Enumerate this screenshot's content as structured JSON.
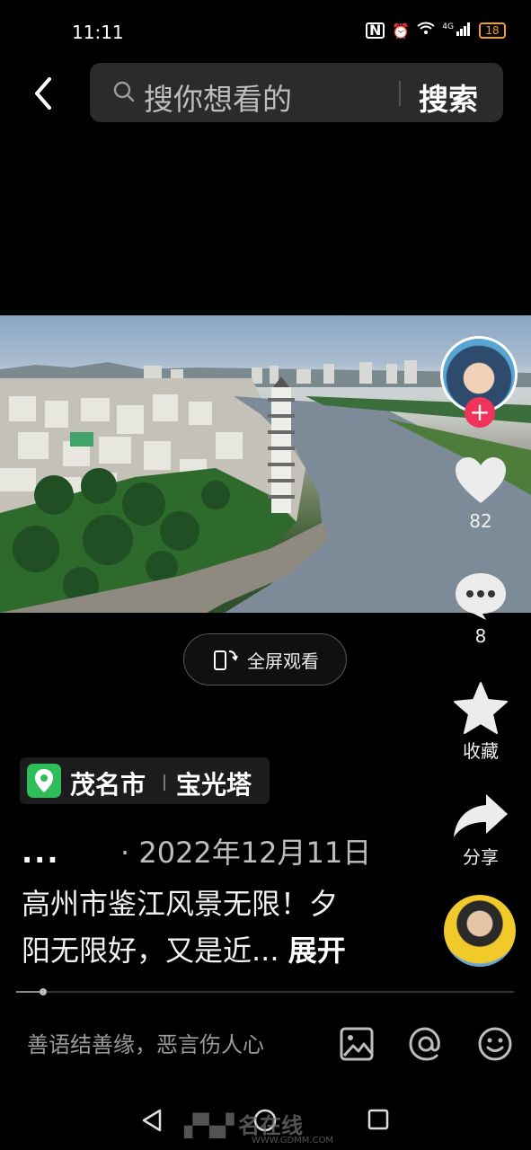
{
  "status_bar": {
    "time": "11:11",
    "network": "4G",
    "battery": "18"
  },
  "search": {
    "placeholder": "搜你想看的",
    "button_label": "搜索"
  },
  "fullscreen_label": "全屏观看",
  "rail": {
    "likes": "82",
    "comments": "8",
    "favorite_label": "收藏",
    "share_label": "分享"
  },
  "location": {
    "city": "茂名市",
    "place": "宝光塔"
  },
  "post": {
    "author": "...",
    "date": "· 2022年12月11日",
    "caption_line1": "高州市鉴江风景无限！夕",
    "caption_line2": "阳无限好，又是近...",
    "expand_label": "展开",
    "progress": 0.05
  },
  "comment_placeholder": "善语结善缘，恶言伤人心",
  "watermark": {
    "text": "名在线",
    "url": "WWW.GDMM.COM"
  }
}
